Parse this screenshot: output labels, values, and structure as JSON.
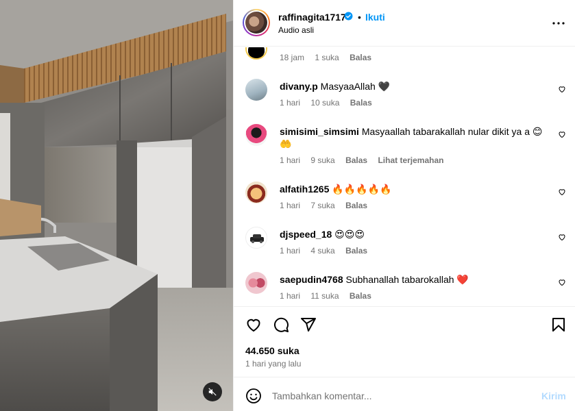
{
  "post": {
    "username": "raffinagita1717",
    "separator": "•",
    "follow_label": "Ikuti",
    "audio_label": "Audio asli",
    "icons": {
      "more": "more-options-icon",
      "verified": "verified-badge-icon",
      "mute": "speaker-muted-icon"
    }
  },
  "comments": [
    {
      "user": "",
      "text": "",
      "time": "18 jam",
      "likes": "1 suka",
      "reply": "Balas",
      "extra": ""
    },
    {
      "user": "divany.p",
      "text": "MasyaaAllah 🖤",
      "time": "1 hari",
      "likes": "10 suka",
      "reply": "Balas",
      "extra": ""
    },
    {
      "user": "simisimi_simsimi",
      "text": "Masyaallah tabarakallah nular dikit ya a 😊",
      "text2": "🤲",
      "time": "1 hari",
      "likes": "9 suka",
      "reply": "Balas",
      "extra": "Lihat terjemahan"
    },
    {
      "user": "alfatih1265",
      "text": "🔥🔥🔥🔥🔥",
      "time": "1 hari",
      "likes": "7 suka",
      "reply": "Balas",
      "extra": ""
    },
    {
      "user": "djspeed_18",
      "text": "😍😍😍",
      "time": "1 hari",
      "likes": "4 suka",
      "reply": "Balas",
      "extra": ""
    },
    {
      "user": "saepudin4768",
      "text": "Subhanallah tabarokallah ❤️",
      "time": "1 hari",
      "likes": "11 suka",
      "reply": "Balas",
      "extra": ""
    }
  ],
  "actions": {
    "likes_count": "44.650 suka",
    "posted": "1 hari yang lalu",
    "icons": [
      "heart-icon",
      "comment-icon",
      "share-icon",
      "bookmark-icon"
    ]
  },
  "composer": {
    "placeholder": "Tambahkan komentar...",
    "send_label": "Kirim"
  },
  "colors": {
    "accent": "#0095f6",
    "send_disabled": "#b3dbff",
    "meta_text": "#737373",
    "heart_red": "#ed4956"
  }
}
